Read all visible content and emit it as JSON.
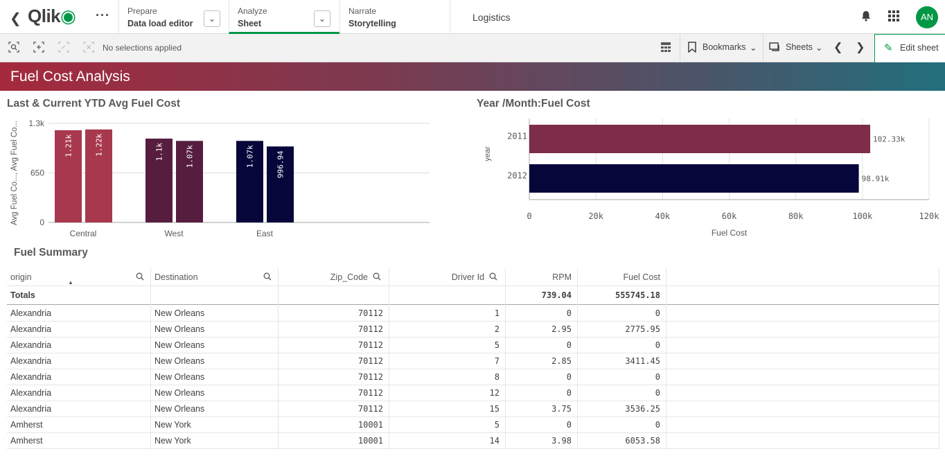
{
  "topbar": {
    "logo": "Qlik",
    "tabs": [
      {
        "small": "Prepare",
        "large": "Data load editor"
      },
      {
        "small": "Analyze",
        "large": "Sheet"
      },
      {
        "small": "Narrate",
        "large": "Storytelling"
      }
    ],
    "app_title": "Logistics",
    "avatar_initials": "AN",
    "accent": "#009845"
  },
  "toolbar": {
    "selections": "No selections applied",
    "bookmarks": "Bookmarks",
    "sheets": "Sheets",
    "edit_sheet": "Edit sheet"
  },
  "sheet": {
    "title": "Fuel Cost Analysis"
  },
  "chart_data": [
    {
      "type": "bar",
      "title": "Last & Current YTD Avg Fuel Cost",
      "ylabel": "Avg Fuel Co..., Avg Fuel Co...",
      "categories": [
        "Central",
        "West",
        "East"
      ],
      "series": [
        {
          "values": [
            1210,
            1100,
            1070
          ],
          "labels": [
            "1.21k",
            "1.1k",
            "1.07k"
          ]
        },
        {
          "values": [
            1220,
            1070,
            996.94
          ],
          "labels": [
            "1.22k",
            "1.07k",
            "996.94"
          ]
        }
      ],
      "colors": {
        "Central": "#a8384d",
        "West": "#561d3f",
        "East": "#06063b"
      },
      "yticks": [
        "0",
        "650",
        "1.3k"
      ],
      "ylim": [
        0,
        1300
      ]
    },
    {
      "type": "bar",
      "orientation": "horizontal",
      "title": "Year /Month:Fuel Cost",
      "ylabel": "year",
      "xlabel": "Fuel Cost",
      "categories": [
        "2011",
        "2012"
      ],
      "values": [
        102330,
        98910
      ],
      "labels": [
        "102.33k",
        "98.91k"
      ],
      "colors": [
        "#7d2c4a",
        "#06063b"
      ],
      "xticks": [
        "0",
        "20k",
        "40k",
        "60k",
        "80k",
        "100k",
        "120k"
      ],
      "xlim": [
        0,
        120000
      ]
    }
  ],
  "table": {
    "title": "Fuel Summary",
    "columns": [
      "origin",
      "Destination",
      "Zip_Code",
      "Driver Id",
      "RPM",
      "Fuel Cost"
    ],
    "totals": {
      "label": "Totals",
      "rpm": "739.04",
      "fuel": "555745.18"
    },
    "rows": [
      [
        "Alexandria",
        "New Orleans",
        "70112",
        "1",
        "0",
        "0"
      ],
      [
        "Alexandria",
        "New Orleans",
        "70112",
        "2",
        "2.95",
        "2775.95"
      ],
      [
        "Alexandria",
        "New Orleans",
        "70112",
        "5",
        "0",
        "0"
      ],
      [
        "Alexandria",
        "New Orleans",
        "70112",
        "7",
        "2.85",
        "3411.45"
      ],
      [
        "Alexandria",
        "New Orleans",
        "70112",
        "8",
        "0",
        "0"
      ],
      [
        "Alexandria",
        "New Orleans",
        "70112",
        "12",
        "0",
        "0"
      ],
      [
        "Alexandria",
        "New Orleans",
        "70112",
        "15",
        "3.75",
        "3536.25"
      ],
      [
        "Amherst",
        "New York",
        "10001",
        "5",
        "0",
        "0"
      ],
      [
        "Amherst",
        "New York",
        "10001",
        "14",
        "3.98",
        "6053.58"
      ]
    ]
  }
}
